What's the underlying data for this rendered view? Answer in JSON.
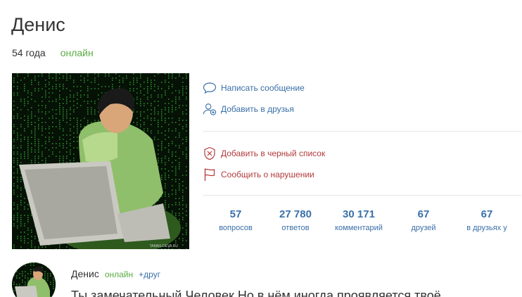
{
  "profile": {
    "name": "Денис",
    "age": "54 года",
    "status": "онлайн"
  },
  "actions": {
    "message": "Написать сообщение",
    "add_friend": "Добавить в друзья",
    "blacklist": "Добавить в черный список",
    "report": "Сообщить о нарушении"
  },
  "stats": [
    {
      "value": "57",
      "label": "вопросов"
    },
    {
      "value": "27 780",
      "label": "ответов"
    },
    {
      "value": "30 171",
      "label": "комментарий"
    },
    {
      "value": "67",
      "label": "друзей"
    },
    {
      "value": "67",
      "label": "в друзьях у"
    }
  ],
  "comment": {
    "author": "Денис",
    "status": "онлайн",
    "relation": "+друг",
    "text": "Ты замечательный Человек Но в нём иногда проявляется твоё"
  },
  "image_watermark": "TAMAS-DEVA.RU",
  "colors": {
    "link": "#3a6fa8",
    "danger": "#b33a3a",
    "online": "#5aac44"
  }
}
